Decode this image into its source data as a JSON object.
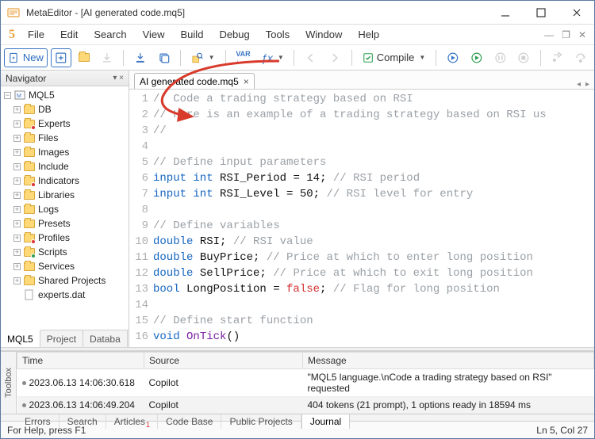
{
  "window": {
    "title": "MetaEditor - [AI generated code.mq5]"
  },
  "menu": {
    "file": "File",
    "edit": "Edit",
    "search": "Search",
    "view": "View",
    "build": "Build",
    "debug": "Debug",
    "tools": "Tools",
    "window": "Window",
    "help": "Help"
  },
  "toolbar": {
    "new": "New",
    "compile": "Compile"
  },
  "navigator": {
    "title": "Navigator",
    "root": "MQL5",
    "items": [
      "DB",
      "Experts",
      "Files",
      "Images",
      "Include",
      "Indicators",
      "Libraries",
      "Logs",
      "Presets",
      "Profiles",
      "Scripts",
      "Services",
      "Shared Projects",
      "experts.dat"
    ],
    "tabs": {
      "mql5": "MQL5",
      "project": "Project",
      "databa": "Databa"
    }
  },
  "file_tab": {
    "name": "AI generated code.mq5"
  },
  "code": {
    "lines": [
      {
        "n": "1",
        "seg": [
          {
            "c": "c-cm",
            "t": "// Code a trading strategy based on RSI"
          }
        ]
      },
      {
        "n": "2",
        "seg": [
          {
            "c": "c-cm",
            "t": "// Here is an example of a trading strategy based on RSI us"
          }
        ]
      },
      {
        "n": "3",
        "seg": [
          {
            "c": "c-cm",
            "t": "//"
          }
        ]
      },
      {
        "n": "4",
        "seg": []
      },
      {
        "n": "5",
        "seg": [
          {
            "c": "c-cm",
            "t": "// Define input parameters"
          }
        ]
      },
      {
        "n": "6",
        "seg": [
          {
            "c": "c-kw",
            "t": "input int"
          },
          {
            "c": "c-id",
            "t": " RSI_Period = "
          },
          {
            "c": "c-num",
            "t": "14"
          },
          {
            "c": "c-id",
            "t": "; "
          },
          {
            "c": "c-cm",
            "t": "// RSI period"
          }
        ]
      },
      {
        "n": "7",
        "seg": [
          {
            "c": "c-kw",
            "t": "input int"
          },
          {
            "c": "c-id",
            "t": " RSI_Level = "
          },
          {
            "c": "c-num",
            "t": "50"
          },
          {
            "c": "c-id",
            "t": "; "
          },
          {
            "c": "c-cm",
            "t": "// RSI level for entry"
          }
        ]
      },
      {
        "n": "8",
        "seg": []
      },
      {
        "n": "9",
        "seg": [
          {
            "c": "c-cm",
            "t": "// Define variables"
          }
        ]
      },
      {
        "n": "10",
        "seg": [
          {
            "c": "c-kw",
            "t": "double"
          },
          {
            "c": "c-id",
            "t": " RSI; "
          },
          {
            "c": "c-cm",
            "t": "// RSI value"
          }
        ]
      },
      {
        "n": "11",
        "seg": [
          {
            "c": "c-kw",
            "t": "double"
          },
          {
            "c": "c-id",
            "t": " BuyPrice; "
          },
          {
            "c": "c-cm",
            "t": "// Price at which to enter long position"
          }
        ]
      },
      {
        "n": "12",
        "seg": [
          {
            "c": "c-kw",
            "t": "double"
          },
          {
            "c": "c-id",
            "t": " SellPrice; "
          },
          {
            "c": "c-cm",
            "t": "// Price at which to exit long position"
          }
        ]
      },
      {
        "n": "13",
        "seg": [
          {
            "c": "c-kw",
            "t": "bool"
          },
          {
            "c": "c-id",
            "t": " LongPosition = "
          },
          {
            "c": "c-bool",
            "t": "false"
          },
          {
            "c": "c-id",
            "t": "; "
          },
          {
            "c": "c-cm",
            "t": "// Flag for long position"
          }
        ]
      },
      {
        "n": "14",
        "seg": []
      },
      {
        "n": "15",
        "seg": [
          {
            "c": "c-cm",
            "t": "// Define start function"
          }
        ]
      },
      {
        "n": "16",
        "seg": [
          {
            "c": "c-kw",
            "t": "void"
          },
          {
            "c": "c-id",
            "t": " "
          },
          {
            "c": "c-fn",
            "t": "OnTick"
          },
          {
            "c": "c-id",
            "t": "()"
          }
        ]
      }
    ]
  },
  "toolbox": {
    "vtab": "Toolbox",
    "cols": {
      "time": "Time",
      "source": "Source",
      "message": "Message"
    },
    "rows": [
      {
        "time": "2023.06.13 14:06:30.618",
        "source": "Copilot",
        "message": "\"MQL5 language.\\nCode a trading strategy based on RSI\" requested"
      },
      {
        "time": "2023.06.13 14:06:49.204",
        "source": "Copilot",
        "message": "404 tokens (21 prompt), 1 options ready in 18594 ms"
      }
    ],
    "tabs": {
      "errors": "Errors",
      "search": "Search",
      "articles": "Articles",
      "codebase": "Code Base",
      "public": "Public Projects",
      "journal": "Journal"
    }
  },
  "status": {
    "help": "For Help, press F1",
    "pos": "Ln 5, Col 27"
  }
}
